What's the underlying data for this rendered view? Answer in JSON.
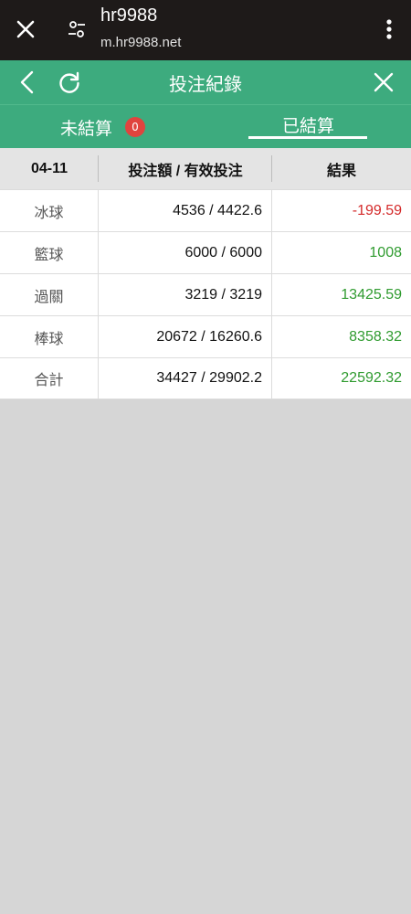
{
  "browser": {
    "title": "hr9988",
    "url": "m.hr9988.net",
    "icons": [
      "close-icon",
      "tune-icon",
      "more-vert-icon"
    ]
  },
  "header": {
    "title": "投注紀錄",
    "icons": [
      "back-icon",
      "refresh-icon",
      "close-icon"
    ]
  },
  "tabs": {
    "unsettled_label": "未結算",
    "unsettled_count": "0",
    "settled_label": "已結算",
    "active": "settled"
  },
  "table": {
    "headers": {
      "date": "04-11",
      "amount": "投注額 / 有效投注",
      "result": "結果"
    },
    "rows": [
      {
        "sport": "冰球",
        "amount": "4536 / 4422.6",
        "result": "-199.59",
        "status": "negative"
      },
      {
        "sport": "籃球",
        "amount": "6000 / 6000",
        "result": "1008",
        "status": "positive"
      },
      {
        "sport": "過關",
        "amount": "3219 / 3219",
        "result": "13425.59",
        "status": "positive"
      },
      {
        "sport": "棒球",
        "amount": "20672 / 16260.6",
        "result": "8358.32",
        "status": "positive"
      },
      {
        "sport": "合計",
        "amount": "34427 / 29902.2",
        "result": "22592.32",
        "status": "positive"
      }
    ]
  },
  "colors": {
    "header_green": "#3dab7e",
    "browser_bar": "#1e1a19",
    "negative": "#d42a2a",
    "positive": "#2f9b2f",
    "badge": "#e0443e",
    "background": "#d6d6d6"
  }
}
